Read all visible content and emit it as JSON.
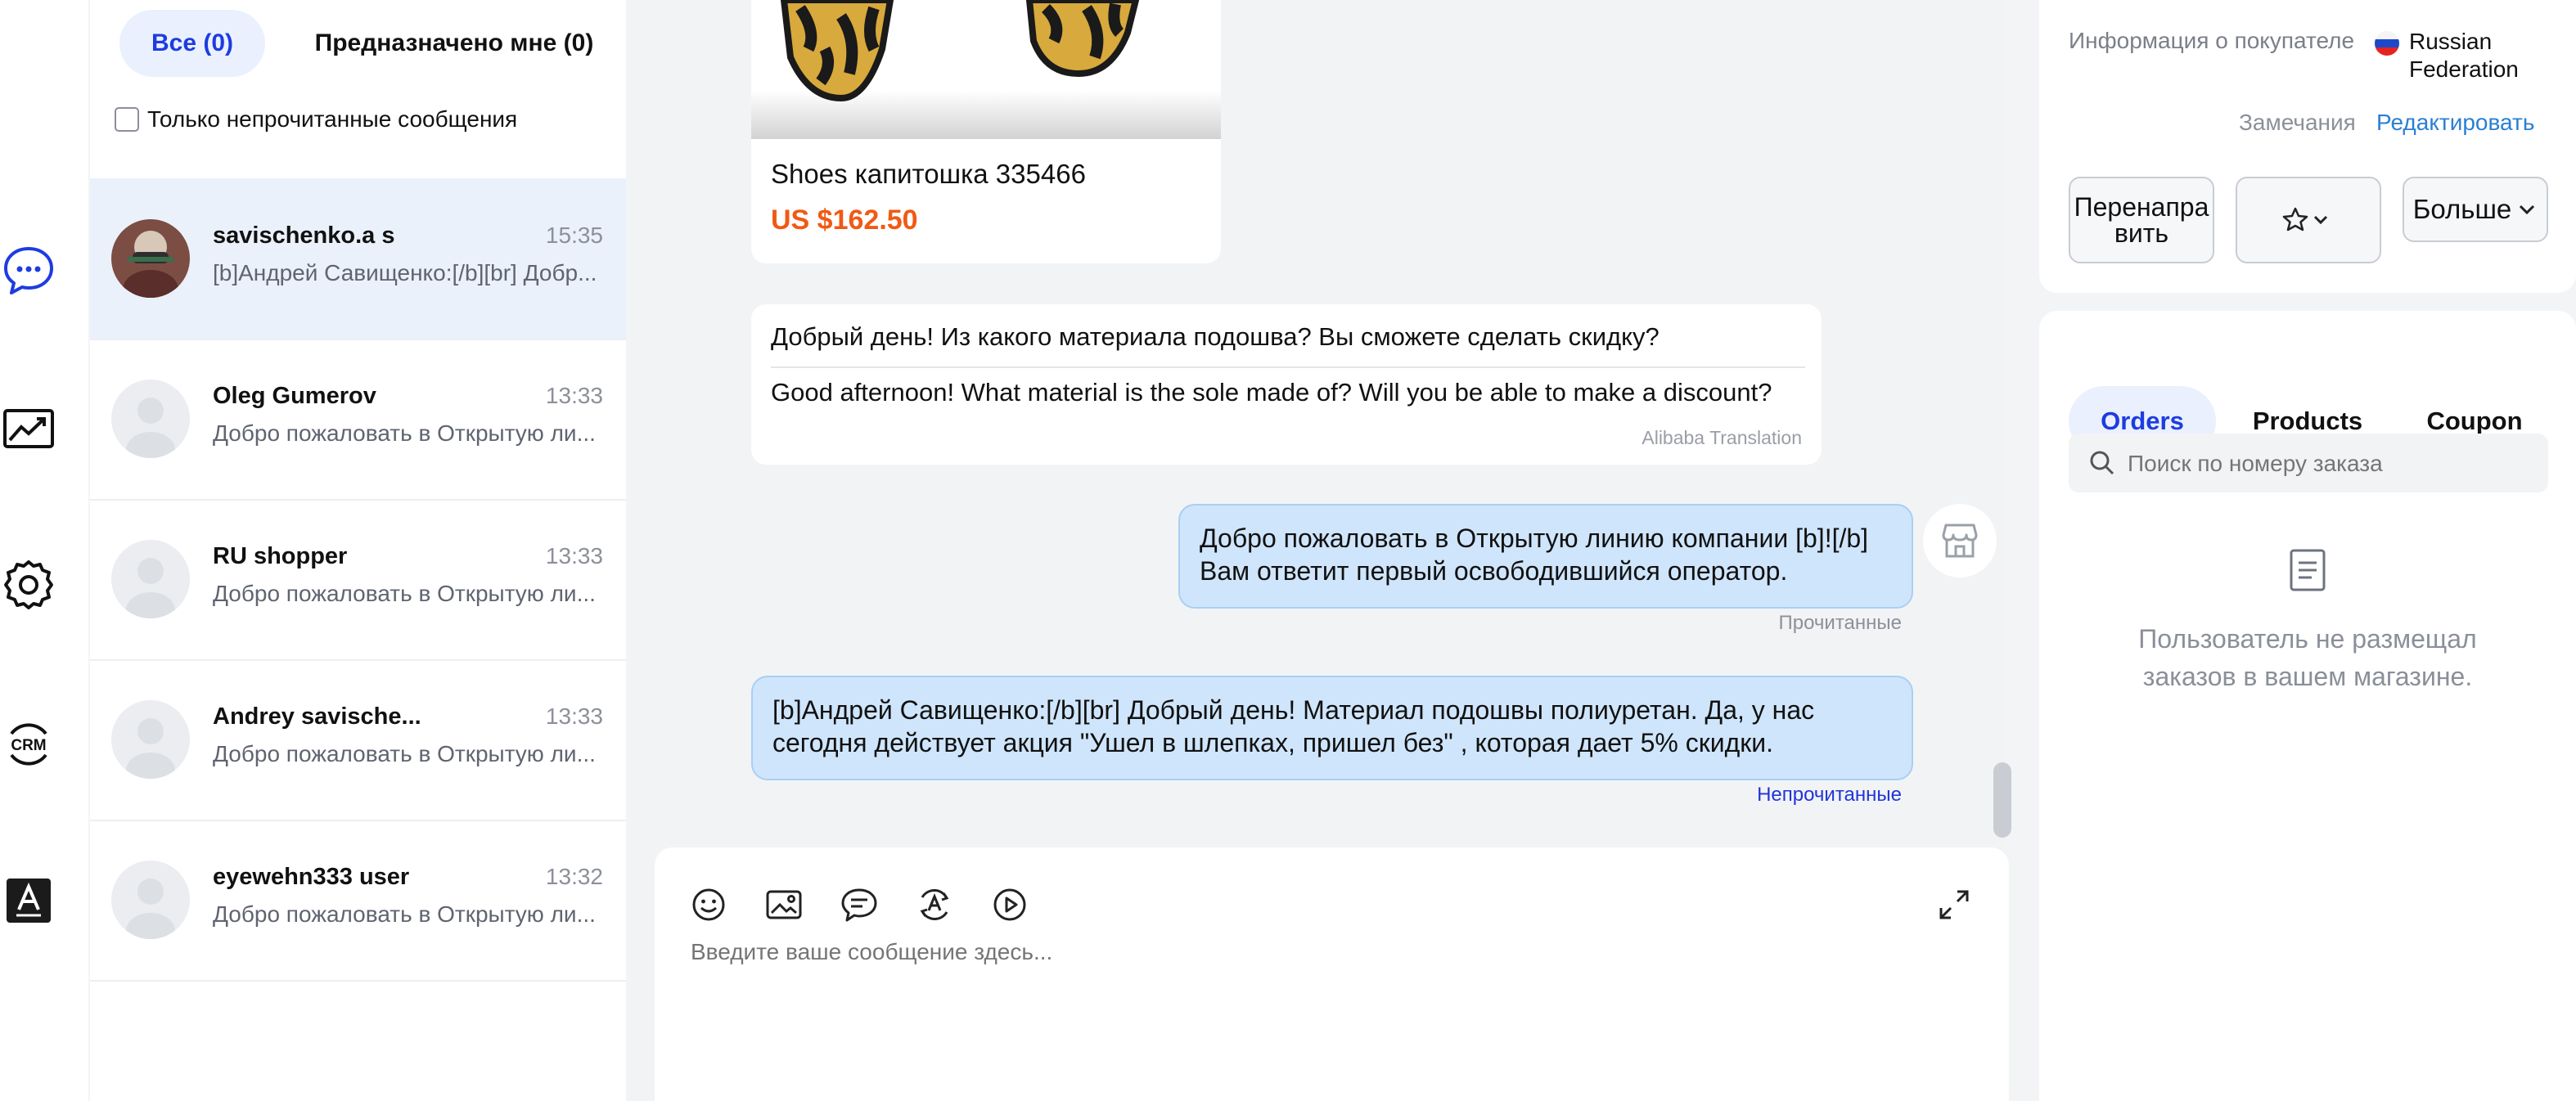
{
  "colors": {
    "accent": "#1d3ce0",
    "link": "#2a7fd4",
    "price": "#f05a14",
    "unread": "#2035d9"
  },
  "rail": {
    "icons": [
      "chat-icon",
      "analytics-icon",
      "settings-icon",
      "crm-icon",
      "translate-icon"
    ],
    "crm_label": "CRM"
  },
  "conversations": {
    "tabs": {
      "all": "Все (0)",
      "assigned": "Предназначено мне (0)"
    },
    "unread_only_label": "Только непрочитанные сообщения",
    "items": [
      {
        "name": "savischenko.a s",
        "time": "15:35",
        "snippet": "[b]Андрей Савищенко:[/b][br] Добр..."
      },
      {
        "name": "Oleg Gumerov",
        "time": "13:33",
        "snippet": "Добро пожаловать в Открытую ли..."
      },
      {
        "name": "RU shopper",
        "time": "13:33",
        "snippet": "Добро пожаловать в Открытую ли..."
      },
      {
        "name": "Andrey savische...",
        "time": "13:33",
        "snippet": "Добро пожаловать в Открытую ли..."
      },
      {
        "name": "eyewehn333 user",
        "time": "13:32",
        "snippet": "Добро пожаловать в Открытую ли..."
      }
    ]
  },
  "chat": {
    "product": {
      "title": "Shoes капитошка 335466",
      "price": "US $162.50"
    },
    "incoming": {
      "original": "Добрый день! Из какого материала подошва? Вы сможете сделать скидку?",
      "translated": "Good afternoon! What material is the sole made of? Will you be able to make a discount?",
      "translation_note": "Alibaba Translation"
    },
    "outgoing": [
      {
        "line1": "Добро пожаловать в Открытую линию компании [b]![/b]",
        "line2": "Вам ответит первый освободившийся оператор.",
        "status": "Прочитанные"
      },
      {
        "line1": "[b]Андрей Савищенко:[/b][br] Добрый день! Материал подошвы полиуретан. Да, у нас",
        "line2": "сегодня действует акция \"Ушел в шлепках, пришел без\" , которая дает 5% скидки.",
        "status": "Непрочитанные"
      }
    ],
    "composer": {
      "placeholder": "Введите ваше сообщение здесь..."
    }
  },
  "buyer": {
    "label": "Информация о покупателе",
    "country_line1": "Russian",
    "country_line2": "Federation",
    "notes": "Замечания",
    "edit": "Редактировать",
    "forward_line1": "Перенапра",
    "forward_line2": "вить",
    "more": "Больше"
  },
  "orders_panel": {
    "tabs": {
      "orders": "Orders",
      "products": "Products",
      "coupon": "Coupon"
    },
    "search_placeholder": "Поиск по номеру заказа",
    "empty_line1": "Пользователь не размещал",
    "empty_line2": "заказов в вашем магазине."
  }
}
